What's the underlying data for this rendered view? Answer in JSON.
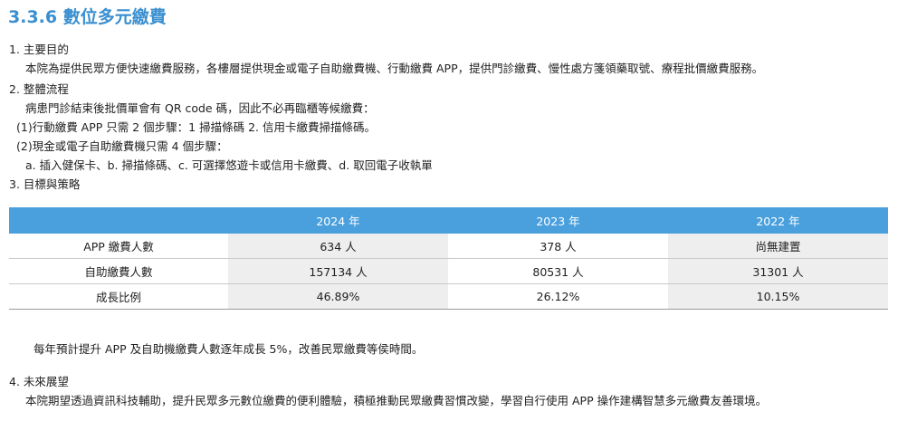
{
  "title": "3.3.6 數位多元繳費",
  "sections": {
    "s1_heading": "1. 主要目的",
    "s1_body": "本院為提供民眾方便快速繳費服務，各樓層提供現金或電子自助繳費機、行動繳費 APP，提供門診繳費、慢性處方箋領藥取號、療程批價繳費服務。",
    "s2_heading": "2. 整體流程",
    "s2_intro": "病患門診結束後批價單會有 QR code 碼，因此不必再臨櫃等候繳費：",
    "s2_item1": "(1)行動繳費 APP 只需 2 個步驟：1 掃描條碼 2. 信用卡繳費掃描條碼。",
    "s2_item2": "(2)現金或電子自助繳費機只需 4 個步驟：",
    "s2_item2_steps": "a. 插入健保卡、b. 掃描條碼、c. 可選擇悠遊卡或信用卡繳費、d. 取回電子收執單",
    "s3_heading": "3. 目標與策略",
    "s3_note": "每年預計提升 APP 及自助機繳費人數逐年成長 5%，改善民眾繳費等侯時間。",
    "s4_heading": "4. 未來展望",
    "s4_body": "本院期望透過資訊科技輔助，提升民眾多元數位繳費的便利體驗，積極推動民眾繳費習慣改變，學習自行使用 APP 操作建構智慧多元繳費友善環境。"
  },
  "table": {
    "headers": [
      "",
      "2024 年",
      "2023 年",
      "2022 年"
    ],
    "rows": [
      {
        "label": "APP 繳費人數",
        "values": [
          "634 人",
          "378 人",
          "尚無建置"
        ]
      },
      {
        "label": "自助繳費人數",
        "values": [
          "157134 人",
          "80531 人",
          "31301 人"
        ]
      },
      {
        "label": "成長比例",
        "values": [
          "46.89%",
          "26.12%",
          "10.15%"
        ]
      }
    ]
  },
  "colors": {
    "title": "#3a8fd0",
    "table_header_bg": "#4aa0dd",
    "shaded_cell_bg": "#eeeeee"
  }
}
